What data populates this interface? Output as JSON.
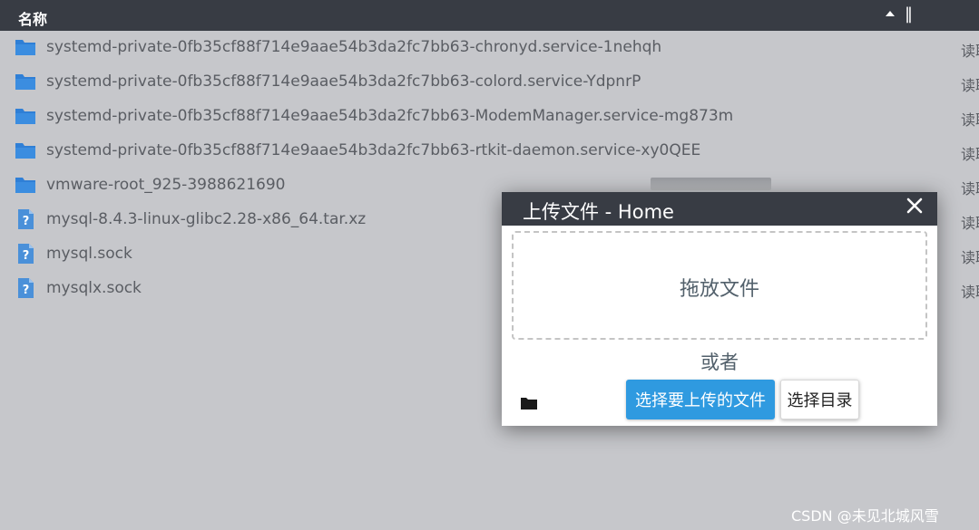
{
  "header": {
    "column_name": "名称",
    "divider_glyph": "‖"
  },
  "files": [
    {
      "name": "systemd-private-0fb35cf88f714e9aae54b3da2fc7bb63-chronyd.service-1nehqh",
      "type": "folder",
      "perm": "读取"
    },
    {
      "name": "systemd-private-0fb35cf88f714e9aae54b3da2fc7bb63-colord.service-YdpnrP",
      "type": "folder",
      "perm": "读取"
    },
    {
      "name": "systemd-private-0fb35cf88f714e9aae54b3da2fc7bb63-ModemManager.service-mg873m",
      "type": "folder",
      "perm": "读取"
    },
    {
      "name": "systemd-private-0fb35cf88f714e9aae54b3da2fc7bb63-rtkit-daemon.service-xy0QEE",
      "type": "folder",
      "perm": "读取"
    },
    {
      "name": "vmware-root_925-3988621690",
      "type": "folder",
      "perm": "读取"
    },
    {
      "name": "mysql-8.4.3-linux-glibc2.28-x86_64.tar.xz",
      "type": "unknown",
      "perm": "读取"
    },
    {
      "name": "mysql.sock",
      "type": "unknown",
      "perm": "读取"
    },
    {
      "name": "mysqlx.sock",
      "type": "unknown",
      "perm": "读取"
    }
  ],
  "dialog": {
    "title": "上传文件 - Home",
    "drop_text": "拖放文件",
    "or_text": "或者",
    "upload_button": "选择要上传的文件",
    "dir_button": "选择目录"
  },
  "watermark": "CSDN @未见北城风雪",
  "colors": {
    "header_bg": "#383c44",
    "page_bg": "#c6c7cb",
    "folder_blue": "#2f7fd6",
    "file_icon_blue": "#4a90d9",
    "primary_button": "#2f9ae0"
  },
  "icons": {
    "folder": "folder-icon",
    "unknown_file": "unknown-file-icon",
    "sort": "sort-up-icon",
    "close": "close-icon"
  }
}
